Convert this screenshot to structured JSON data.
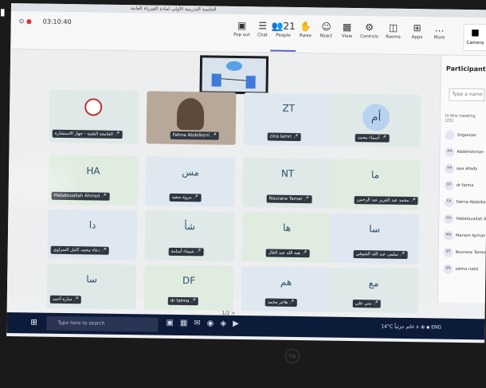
{
  "titlebar": {
    "text": "الجلسة التدريبية الأولى لمادة الفيزياء العامة"
  },
  "recording": {
    "time": "03:10:40"
  },
  "toolbar": {
    "buttons": [
      {
        "icon": "▣",
        "label": "Pop out"
      },
      {
        "icon": "☰",
        "label": "Chat"
      },
      {
        "icon": "👥",
        "label": "People",
        "badge": "21"
      },
      {
        "icon": "✋",
        "label": "Raise"
      },
      {
        "icon": "☺",
        "label": "React"
      },
      {
        "icon": "▦",
        "label": "View"
      },
      {
        "icon": "⚙",
        "label": "Controls"
      },
      {
        "icon": "◫",
        "label": "Rooms"
      },
      {
        "icon": "⊞",
        "label": "Apps"
      },
      {
        "icon": "…",
        "label": "More"
      }
    ],
    "camera_label": "Camera"
  },
  "tiles": [
    {
      "initials": "",
      "name": "الجامعة التقنية - جهاز الاستشارة",
      "type": "logo"
    },
    {
      "initials": "",
      "name": "Fatma Abdelkerri",
      "type": "video"
    },
    {
      "initials": "ZT",
      "name": "zina lamri",
      "type": "initials"
    },
    {
      "initials": "أم",
      "name": "أسماء محمد",
      "type": "bubble"
    },
    {
      "initials": "HA",
      "name": "Hebatouallah Ahmed",
      "type": "initials"
    },
    {
      "initials": "مس",
      "name": "مروة سعيد",
      "type": "initials"
    },
    {
      "initials": "NT",
      "name": "Nourane Tamar",
      "type": "initials"
    },
    {
      "initials": "ما",
      "name": "محمد عبد العزيز عبد الرحمن",
      "type": "initials"
    },
    {
      "initials": "دا",
      "name": "دعاء محمد كامل السراوي",
      "type": "initials"
    },
    {
      "initials": "شأ",
      "name": "شيماء أسامة",
      "type": "initials"
    },
    {
      "initials": "ها",
      "name": "هبة الله عبد العال",
      "type": "initials"
    },
    {
      "initials": "سا",
      "name": "سلمى عبد الله الشوفي",
      "type": "initials"
    },
    {
      "initials": "سا",
      "name": "سارة أحمد",
      "type": "initials"
    },
    {
      "initials": "DF",
      "name": "dr fatma",
      "type": "initials"
    },
    {
      "initials": "هم",
      "name": "هاجر محمد",
      "type": "initials"
    },
    {
      "initials": "مع",
      "name": "مني علي",
      "type": "initials"
    }
  ],
  "pager": {
    "text": "1/2 >"
  },
  "panel": {
    "title": "Participants",
    "search_placeholder": "Type a name",
    "section": "In this meeting (21)",
    "people": [
      {
        "av": "",
        "name": "Organizer"
      },
      {
        "av": "AA",
        "name": "Abdelrahman"
      },
      {
        "av": "AA",
        "name": "aya ahady"
      },
      {
        "av": "DF",
        "name": "dr fatma"
      },
      {
        "av": "FA",
        "name": "Fatma Abdelkerri"
      },
      {
        "av": "HA",
        "name": "Hebatouallah Ahm"
      },
      {
        "av": "MA",
        "name": "Mariam Ayman"
      },
      {
        "av": "NT",
        "name": "Nourane Tamer"
      },
      {
        "av": "SN",
        "name": "salma nabil"
      }
    ]
  },
  "taskbar": {
    "search_placeholder": "Type here to search",
    "weather": "14°C غائم جزئياً",
    "lang": "ENG"
  },
  "colors": {
    "accent": "#5b5fc7",
    "taskbar": "#0d1b3a",
    "tile": "#dfe9e8"
  }
}
